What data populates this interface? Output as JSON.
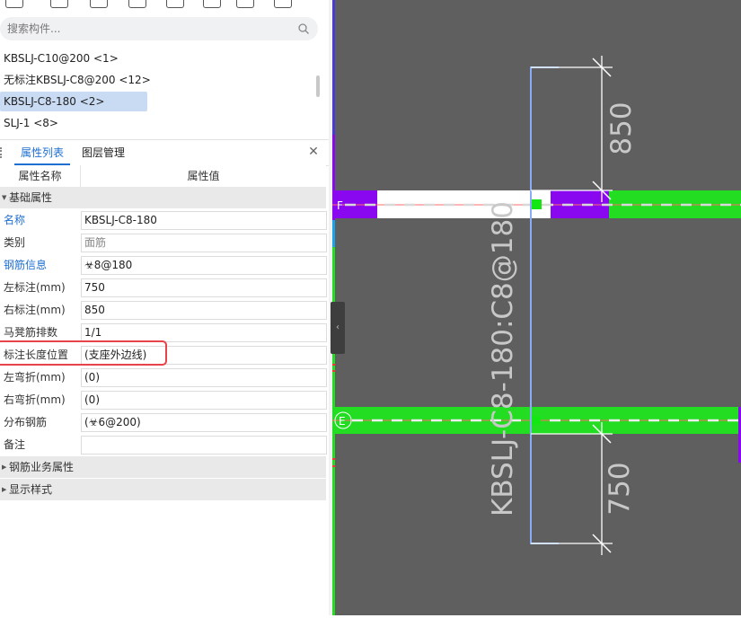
{
  "search": {
    "placeholder": "搜索构件..."
  },
  "components": [
    {
      "label": "KBSLJ-C10@200 <1>"
    },
    {
      "label": "无标注KBSLJ-C8@200 <12>"
    },
    {
      "label": "KBSLJ-C8-180 <2>",
      "selected": true
    },
    {
      "label": "SLJ-1 <8>"
    }
  ],
  "tabs": {
    "properties": "属性列表",
    "layers": "图层管理"
  },
  "table": {
    "name_header": "属性名称",
    "value_header": "属性值"
  },
  "groups": {
    "basic": "基础属性",
    "rebar_business": "钢筋业务属性",
    "display_style": "显示样式"
  },
  "props": {
    "name": {
      "label": "名称",
      "value": "KBSLJ-C8-180"
    },
    "category": {
      "label": "类别",
      "value": "面筋"
    },
    "rebar_info": {
      "label": "钢筋信息",
      "value": "☣8@180"
    },
    "left_mark": {
      "label": "左标注(mm)",
      "value": "750"
    },
    "right_mark": {
      "label": "右标注(mm)",
      "value": "850"
    },
    "chair_rows": {
      "label": "马凳筋排数",
      "value": "1/1"
    },
    "mark_length_pos": {
      "label": "标注长度位置",
      "value": "(支座外边线)"
    },
    "left_bend": {
      "label": "左弯折(mm)",
      "value": "(0)"
    },
    "right_bend": {
      "label": "右弯折(mm)",
      "value": "(0)"
    },
    "distribution": {
      "label": "分布钢筋",
      "value": "(☣6@200)"
    },
    "remark": {
      "label": "备注",
      "value": ""
    }
  },
  "drawing": {
    "dim_top": "850",
    "dim_bottom": "750",
    "rebar_label": "KBSLJ-C8-180:C8@180",
    "beam_top_label": "F",
    "beam_bottom_label": "E",
    "colors": {
      "canvas": "#5f5f5f",
      "green": "#22dd22",
      "purple": "#8a08f0",
      "blue_line": "#8aabf7",
      "red_line": "#ff6b6b",
      "white": "#ffffff"
    }
  }
}
